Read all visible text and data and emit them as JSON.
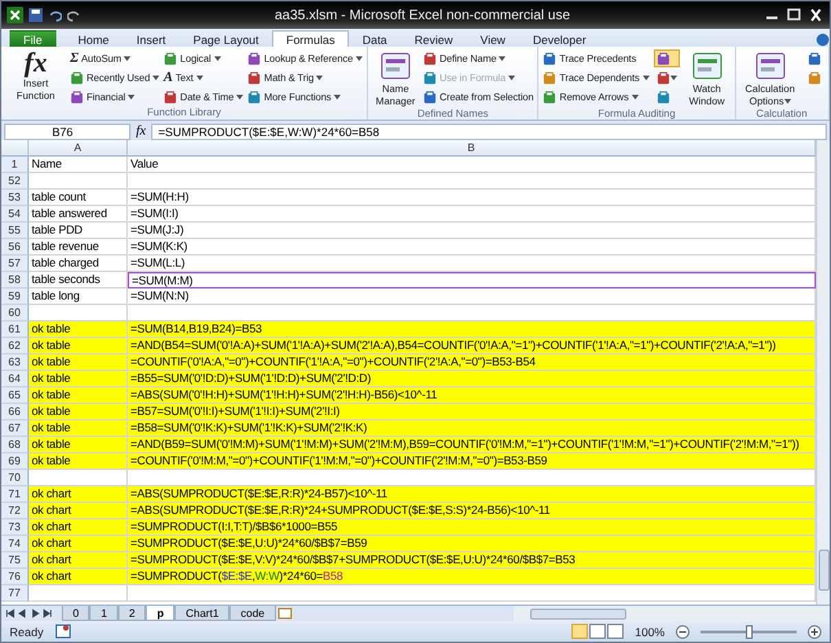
{
  "window": {
    "title": "aa35.xlsm  -  Microsoft Excel non-commercial use"
  },
  "ribbon_tabs": [
    {
      "label": "File",
      "kind": "file",
      "selected": false
    },
    {
      "label": "Home",
      "kind": "tab",
      "selected": false
    },
    {
      "label": "Insert",
      "kind": "tab",
      "selected": false
    },
    {
      "label": "Page Layout",
      "kind": "tab",
      "selected": false
    },
    {
      "label": "Formulas",
      "kind": "tab",
      "selected": true
    },
    {
      "label": "Data",
      "kind": "tab",
      "selected": false
    },
    {
      "label": "Review",
      "kind": "tab",
      "selected": false
    },
    {
      "label": "View",
      "kind": "tab",
      "selected": false
    },
    {
      "label": "Developer",
      "kind": "tab",
      "selected": false
    }
  ],
  "ribbon_groups": [
    {
      "label": "Function Library",
      "columns": [
        [
          {
            "kind": "large",
            "label": "Insert Function",
            "glyph": "fx",
            "dropdown": false
          }
        ],
        [
          {
            "kind": "small",
            "label": "AutoSum",
            "glyph": "Σ",
            "dropdown": true
          },
          {
            "kind": "small",
            "label": "Recently Used",
            "dropdown": true
          },
          {
            "kind": "small",
            "label": "Financial",
            "dropdown": true
          }
        ],
        [
          {
            "kind": "small",
            "label": "Logical",
            "dropdown": true
          },
          {
            "kind": "small",
            "label": "Text",
            "glyph": "A",
            "dropdown": true
          },
          {
            "kind": "small",
            "label": "Date & Time",
            "dropdown": true
          }
        ],
        [
          {
            "kind": "small",
            "label": "Lookup & Reference",
            "dropdown": true
          },
          {
            "kind": "small",
            "label": "Math & Trig",
            "dropdown": true
          },
          {
            "kind": "small",
            "label": "More Functions",
            "dropdown": true
          }
        ]
      ]
    },
    {
      "label": "Defined Names",
      "columns": [
        [
          {
            "kind": "large",
            "label": "Name Manager",
            "dropdown": false
          }
        ],
        [
          {
            "kind": "small",
            "label": "Define Name",
            "dropdown": true
          },
          {
            "kind": "small",
            "label": "Use in Formula",
            "dropdown": true,
            "disabled": true
          },
          {
            "kind": "small",
            "label": "Create from Selection",
            "dropdown": false
          }
        ]
      ]
    },
    {
      "label": "Formula Auditing",
      "columns": [
        [
          {
            "kind": "small",
            "label": "Trace Precedents",
            "dropdown": false
          },
          {
            "kind": "small",
            "label": "Trace Dependents",
            "dropdown": true
          },
          {
            "kind": "small",
            "label": "Remove Arrows",
            "dropdown": true
          }
        ],
        [
          {
            "kind": "icon",
            "dropdown": false,
            "selected": true
          },
          {
            "kind": "icon",
            "dropdown": true,
            "selected": false
          },
          {
            "kind": "icon",
            "dropdown": false,
            "selected": false
          }
        ],
        [
          {
            "kind": "large",
            "label": "Watch Window",
            "dropdown": false
          }
        ]
      ]
    },
    {
      "label": "Calculation",
      "columns": [
        [
          {
            "kind": "large",
            "label": "Calculation Options",
            "dropdown": true
          }
        ],
        [
          {
            "kind": "icon",
            "dropdown": false,
            "selected": false
          },
          {
            "kind": "icon",
            "dropdown": false,
            "selected": false
          }
        ]
      ]
    }
  ],
  "formula_bar": {
    "name_box": "B76",
    "fx": "fx",
    "formula": "=SUMPRODUCT($E:$E,W:W)*24*60=B58"
  },
  "columns": [
    "A",
    "B"
  ],
  "rows": [
    {
      "number": "1",
      "name": "Name",
      "value": "Value",
      "highlighted": false
    },
    {
      "number": "52",
      "highlighted": false
    },
    {
      "number": "53",
      "name": "table count",
      "value": "=SUM(H:H)",
      "highlighted": false
    },
    {
      "number": "54",
      "name": "table answered",
      "value": "=SUM(I:I)",
      "highlighted": false
    },
    {
      "number": "55",
      "name": "table PDD",
      "value": "=SUM(J:J)",
      "highlighted": false
    },
    {
      "number": "56",
      "name": "table revenue",
      "value": "=SUM(K:K)",
      "highlighted": false
    },
    {
      "number": "57",
      "name": "table charged",
      "value": "=SUM(L:L)",
      "highlighted": false
    },
    {
      "number": "58",
      "name": "table seconds",
      "value": "=SUM(M:M)",
      "highlighted": false,
      "referenced": true
    },
    {
      "number": "59",
      "name": "table long",
      "value": "=SUM(N:N)",
      "highlighted": false
    },
    {
      "number": "60",
      "highlighted": false
    },
    {
      "number": "61",
      "name": "ok table",
      "value": "=SUM(B14,B19,B24)=B53",
      "highlighted": true
    },
    {
      "number": "62",
      "name": "ok table",
      "value": "=AND(B54=SUM('0'!A:A)+SUM('1'!A:A)+SUM('2'!A:A),B54=COUNTIF('0'!A:A,\"=1\")+COUNTIF('1'!A:A,\"=1\")+COUNTIF('2'!A:A,\"=1\"))",
      "highlighted": true
    },
    {
      "number": "63",
      "name": "ok table",
      "value": "=COUNTIF('0'!A:A,\"=0\")+COUNTIF('1'!A:A,\"=0\")+COUNTIF('2'!A:A,\"=0\")=B53-B54",
      "highlighted": true
    },
    {
      "number": "64",
      "name": "ok table",
      "value": "=B55=SUM('0'!D:D)+SUM('1'!D:D)+SUM('2'!D:D)",
      "highlighted": true
    },
    {
      "number": "65",
      "name": "ok table",
      "value": "=ABS(SUM('0'!H:H)+SUM('1'!H:H)+SUM('2'!H:H)-B56)<10^-11",
      "highlighted": true
    },
    {
      "number": "66",
      "name": "ok table",
      "value": "=B57=SUM('0'!I:I)+SUM('1'!I:I)+SUM('2'!I:I)",
      "highlighted": true
    },
    {
      "number": "67",
      "name": "ok table",
      "value": "=B58=SUM('0'!K:K)+SUM('1'!K:K)+SUM('2'!K:K)",
      "highlighted": true
    },
    {
      "number": "68",
      "name": "ok table",
      "value": "=AND(B59=SUM('0'!M:M)+SUM('1'!M:M)+SUM('2'!M:M),B59=COUNTIF('0'!M:M,\"=1\")+COUNTIF('1'!M:M,\"=1\")+COUNTIF('2'!M:M,\"=1\"))",
      "highlighted": true
    },
    {
      "number": "69",
      "name": "ok table",
      "value": "=COUNTIF('0'!M:M,\"=0\")+COUNTIF('1'!M:M,\"=0\")+COUNTIF('2'!M:M,\"=0\")=B53-B59",
      "highlighted": true
    },
    {
      "number": "70",
      "highlighted": false
    },
    {
      "number": "71",
      "name": "ok chart",
      "value": "=ABS(SUMPRODUCT($E:$E,R:R)*24-B57)<10^-11",
      "highlighted": true
    },
    {
      "number": "72",
      "name": "ok chart",
      "value": "=ABS(SUMPRODUCT($E:$E,R:R)*24+SUMPRODUCT($E:$E,S:S)*24-B56)<10^-11",
      "highlighted": true
    },
    {
      "number": "73",
      "name": "ok chart",
      "value": "=SUMPRODUCT(I:I,T:T)/$B$6*1000=B55",
      "highlighted": true
    },
    {
      "number": "74",
      "name": "ok chart",
      "value": "=SUMPRODUCT($E:$E,U:U)*24*60/$B$7=B59",
      "highlighted": true
    },
    {
      "number": "75",
      "name": "ok chart",
      "value": "=SUMPRODUCT($E:$E,V:V)*24*60/$B$7+SUMPRODUCT($E:$E,U:U)*24*60/$B$7=B53",
      "highlighted": true
    },
    {
      "number": "76",
      "name": "ok chart",
      "segments": [
        {
          "text": "=SUMPRODUCT("
        },
        {
          "text": "$E:$E",
          "color": "#3333cc"
        },
        {
          "text": ","
        },
        {
          "text": "W:W",
          "color": "#108010"
        },
        {
          "text": ")*24*60="
        },
        {
          "text": "B58",
          "color": "#b02aa8"
        }
      ],
      "highlighted": true
    },
    {
      "number": "77",
      "highlighted": false
    }
  ],
  "sheet_tabs": [
    {
      "label": "0",
      "selected": false
    },
    {
      "label": "1",
      "selected": false
    },
    {
      "label": "2",
      "selected": false
    },
    {
      "label": "p",
      "selected": true
    },
    {
      "label": "Chart1",
      "selected": false
    },
    {
      "label": "code",
      "selected": false
    }
  ],
  "status_bar": {
    "mode": "Ready",
    "zoom": "100%",
    "zoom_slider": {
      "level": 0.5
    }
  }
}
